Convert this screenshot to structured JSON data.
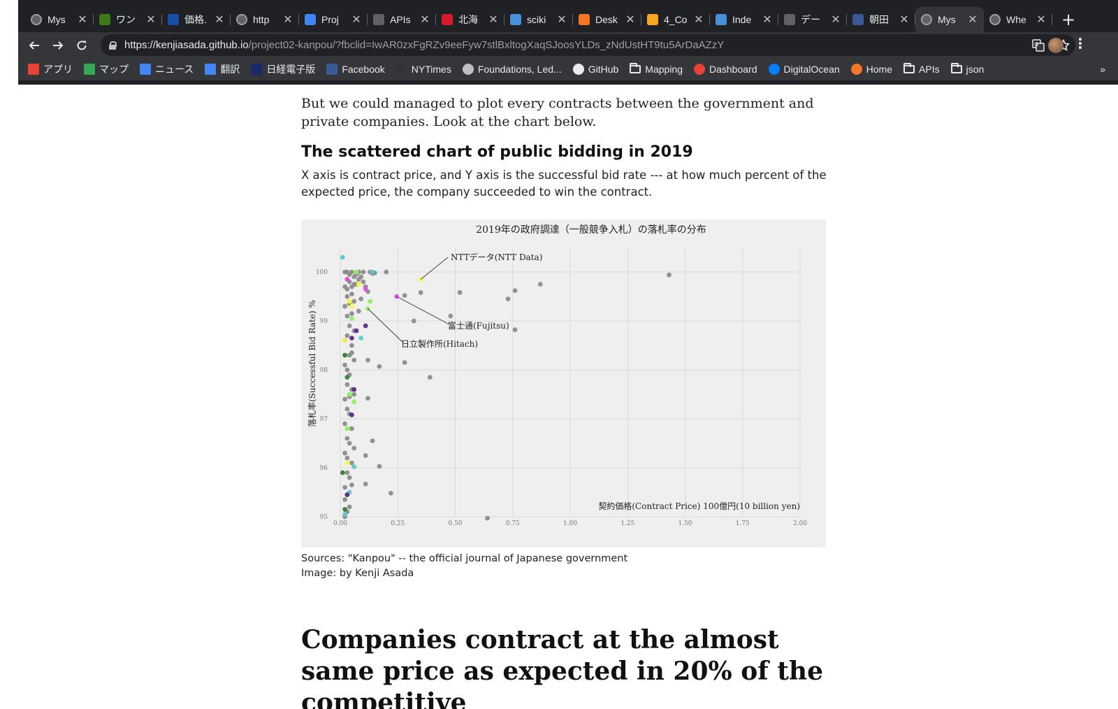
{
  "browser": {
    "tabs": [
      {
        "title": "Mys",
        "icon": "globe-icon",
        "color": "#5f6368"
      },
      {
        "title": "ワン",
        "icon": "b-logo-icon",
        "color": "#3d7a1a"
      },
      {
        "title": "価格.",
        "icon": "kakaku-icon",
        "color": "#1a4da6"
      },
      {
        "title": "http",
        "icon": "globe-icon",
        "color": "#5f6368"
      },
      {
        "title": "Proj",
        "icon": "docs-icon",
        "color": "#4285f4"
      },
      {
        "title": "APIs",
        "icon": "gear-icon",
        "color": "#5f6368"
      },
      {
        "title": "北海",
        "icon": "m-logo-icon",
        "color": "#d7192b"
      },
      {
        "title": "sciki",
        "icon": "ds-icon",
        "color": "#4a90d9"
      },
      {
        "title": "Desk",
        "icon": "arc-icon",
        "color": "#f37726"
      },
      {
        "title": "4_Co",
        "icon": "notebook-icon",
        "color": "#f5a623"
      },
      {
        "title": "Inde",
        "icon": "chart-icon",
        "color": "#4a90d9"
      },
      {
        "title": "デー",
        "icon": "hand-icon",
        "color": "#5f6368"
      },
      {
        "title": "朝田",
        "icon": "facebook-icon",
        "color": "#3b5998"
      },
      {
        "title": "Mys",
        "icon": "globe-icon",
        "color": "#5f6368",
        "active": true
      },
      {
        "title": "Whe",
        "icon": "globe-icon",
        "color": "#5f6368"
      }
    ],
    "url_host": "https://kenjiasada.github.io",
    "url_path": "/project02-kanpou/?fbclid=IwAR0zxFgRZv9eeFyw7stlBxltogXaqSJoosYLDs_zNdUstHT9tu5ArDaAZzY",
    "bookmarks": [
      {
        "label": "アプリ",
        "icon": "apps-grid-icon",
        "color": "#ea4335"
      },
      {
        "label": "マップ",
        "icon": "maps-icon",
        "color": "#34a853"
      },
      {
        "label": "ニュース",
        "icon": "news-icon",
        "color": "#4285f4"
      },
      {
        "label": "翻訳",
        "icon": "translate-icon",
        "color": "#4285f4"
      },
      {
        "label": "日経電子版",
        "icon": "nikkei-icon",
        "color": "#1c2a6b"
      },
      {
        "label": "Facebook",
        "icon": "facebook-icon",
        "color": "#3b5998"
      },
      {
        "label": "NYTimes",
        "icon": "nyt-icon",
        "color": "#333333"
      },
      {
        "label": "Foundations, Led...",
        "icon": "globe-icon",
        "color": "#bdc1c6"
      },
      {
        "label": "GitHub",
        "icon": "github-icon",
        "color": "#e8eaed"
      },
      {
        "label": "Mapping",
        "icon": "folder-icon",
        "color": "#e8eaed"
      },
      {
        "label": "Dashboard",
        "icon": "dashboard-icon",
        "color": "#ea4335"
      },
      {
        "label": "DigitalOcean",
        "icon": "digitalocean-icon",
        "color": "#0080ff"
      },
      {
        "label": "Home",
        "icon": "arc-icon",
        "color": "#f37726"
      },
      {
        "label": "APIs",
        "icon": "folder-icon",
        "color": "#e8eaed"
      },
      {
        "label": "json",
        "icon": "folder-icon",
        "color": "#e8eaed"
      }
    ],
    "more": "»"
  },
  "article": {
    "intro": "But we could managed to plot every contracts between the government and private companies. Look at the chart below.",
    "chart_heading": "The scattered chart of public bidding in 2019",
    "chart_desc": "X axis is contract price, and Y axis is the successful bid rate --- at how much percent of the expected price, the company succeeded to win the contract.",
    "credit_source": "Sources: \"Kanpou\" -- the official journal of Japanese government",
    "credit_image": "Image: by Kenji Asada",
    "section_heading": "Companies contract at the almost same price as expected in 20% of the competitive"
  },
  "chart_data": {
    "type": "scatter",
    "title": "2019年の政府調達（一般競争入札）の落札率の分布",
    "xlabel": "契約価格(Contract Price) 100億円(10 billion yen)",
    "ylabel": "落札率(Successful Bid Rate) %",
    "xlim": [
      0,
      2.0
    ],
    "ylim": [
      95,
      100.5
    ],
    "x_ticks": [
      "0.00",
      "0.25",
      "0.50",
      "0.75",
      "1.00",
      "1.25",
      "1.50",
      "1.75",
      "2.00"
    ],
    "y_ticks": [
      "95",
      "96",
      "97",
      "98",
      "99",
      "100"
    ],
    "grid": true,
    "legend": "none",
    "annotations": [
      {
        "text": "NTTデータ(NTT Data)",
        "x": 0.35,
        "y": 99.85
      },
      {
        "text": "富士通(Fujitsu)",
        "x": 0.245,
        "y": 99.5
      },
      {
        "text": "日立製作所(Hitach)",
        "x": 0.12,
        "y": 99.25
      }
    ],
    "series": [
      {
        "color": "#8c8c8c",
        "x": [
          0.02,
          0.03,
          0.04,
          0.05,
          0.06,
          0.07,
          0.08,
          0.09,
          0.1,
          0.13,
          0.15,
          0.2,
          0.03,
          0.04,
          0.06,
          0.08,
          0.1,
          0.14,
          0.02,
          0.03,
          0.05,
          0.07,
          0.11,
          0.28,
          0.35,
          0.52,
          0.73,
          0.76,
          0.87,
          1.43,
          0.03,
          0.05,
          0.09,
          0.12,
          0.02,
          0.04,
          0.06,
          0.03,
          0.05,
          0.08,
          0.32,
          0.48,
          0.04,
          0.06,
          0.02,
          0.03,
          0.05,
          0.76,
          0.04,
          0.05,
          0.02,
          0.03,
          0.06,
          0.04,
          0.12,
          0.17,
          0.28,
          0.39,
          0.03,
          0.05,
          0.02,
          0.04,
          0.06,
          0.03,
          0.04,
          0.12,
          0.02,
          0.05,
          0.03,
          0.04,
          0.06,
          0.14,
          0.02,
          0.03,
          0.05,
          0.11,
          0.17,
          0.03,
          0.04,
          0.02,
          0.05,
          0.03,
          0.11,
          0.02,
          0.04,
          0.22,
          0.03,
          0.02,
          0.64
        ],
        "y": [
          100.0,
          100.0,
          99.95,
          100.0,
          99.9,
          99.95,
          100.0,
          99.9,
          100.0,
          100.0,
          99.98,
          100.0,
          99.85,
          99.8,
          99.75,
          99.85,
          99.8,
          99.97,
          99.7,
          99.65,
          99.7,
          99.75,
          99.7,
          99.52,
          99.58,
          99.58,
          99.45,
          99.62,
          99.75,
          99.94,
          99.5,
          99.55,
          99.45,
          99.6,
          99.3,
          99.35,
          99.4,
          99.1,
          99.15,
          99.2,
          99.0,
          99.1,
          98.9,
          98.8,
          98.6,
          98.7,
          98.5,
          98.82,
          98.3,
          98.35,
          98.1,
          98.0,
          98.2,
          97.9,
          98.2,
          98.07,
          98.15,
          97.85,
          97.7,
          97.6,
          97.4,
          97.45,
          97.5,
          97.2,
          97.1,
          97.42,
          96.9,
          96.8,
          96.6,
          96.5,
          96.4,
          96.55,
          96.3,
          96.2,
          96.1,
          96.25,
          96.03,
          95.9,
          95.8,
          95.6,
          95.65,
          95.45,
          95.67,
          95.35,
          95.2,
          95.48,
          95.1,
          95.0,
          94.97
        ]
      },
      {
        "color": "#5bc8d4",
        "x": [
          0.01,
          0.14,
          0.09,
          0.06,
          0.04,
          0.02
        ],
        "y": [
          100.3,
          100.0,
          98.65,
          96.02,
          95.5,
          95.05
        ]
      },
      {
        "color": "#f5f542",
        "x": [
          0.35,
          0.08,
          0.04,
          0.05,
          0.02,
          0.03
        ],
        "y": [
          99.85,
          99.75,
          99.4,
          99.3,
          98.6,
          96.1
        ]
      },
      {
        "color": "#8cf25a",
        "x": [
          0.12,
          0.13,
          0.07,
          0.05,
          0.04,
          0.06,
          0.03
        ],
        "y": [
          99.25,
          99.4,
          100.0,
          99.05,
          97.5,
          97.35,
          96.8
        ]
      },
      {
        "color": "#e24ee2",
        "x": [
          0.245,
          0.11,
          0.03
        ],
        "y": [
          99.5,
          99.65,
          99.85
        ]
      },
      {
        "color": "#5a2a8a",
        "x": [
          0.11,
          0.07,
          0.05,
          0.06,
          0.05,
          0.03
        ],
        "y": [
          98.9,
          98.8,
          98.65,
          97.6,
          97.08,
          95.45
        ]
      },
      {
        "color": "#2e7d32",
        "x": [
          0.02,
          0.03,
          0.01,
          0.02
        ],
        "y": [
          98.3,
          97.85,
          95.9,
          95.15
        ]
      }
    ]
  }
}
